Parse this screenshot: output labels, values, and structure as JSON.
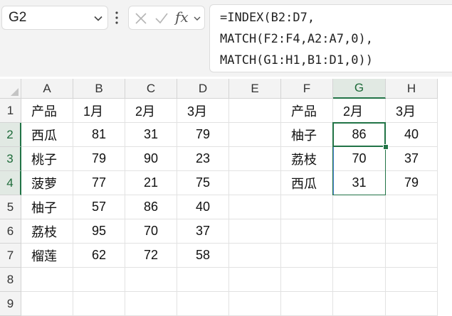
{
  "name_box": {
    "value": "G2"
  },
  "formula_bar": {
    "fx_label": "fx",
    "lines": [
      "=INDEX(B2:D7,",
      "MATCH(F2:F4,A2:A7,0),",
      "MATCH(G1:H1,B1:D1,0))"
    ]
  },
  "columns": [
    "A",
    "B",
    "C",
    "D",
    "E",
    "F",
    "G",
    "H"
  ],
  "rows": [
    "1",
    "2",
    "3",
    "4",
    "5",
    "6",
    "7",
    "8",
    "9"
  ],
  "cells": {
    "A1": "产品",
    "B1": "1月",
    "C1": "2月",
    "D1": "3月",
    "A2": "西瓜",
    "B2": "81",
    "C2": "31",
    "D2": "79",
    "A3": "桃子",
    "B3": "79",
    "C3": "90",
    "D3": "23",
    "A4": "菠萝",
    "B4": "77",
    "C4": "21",
    "D4": "75",
    "A5": "柚子",
    "B5": "57",
    "C5": "86",
    "D5": "40",
    "A6": "荔枝",
    "B6": "95",
    "C6": "70",
    "D6": "37",
    "A7": "榴莲",
    "B7": "62",
    "C7": "72",
    "D7": "58",
    "F1": "产品",
    "G1": "2月",
    "H1": "3月",
    "F2": "柚子",
    "G2": "86",
    "H2": "40",
    "F3": "荔枝",
    "G3": "70",
    "H3": "37",
    "F4": "西瓜",
    "G4": "31",
    "H4": "79"
  },
  "selection": {
    "active_cell": "G2",
    "range": "G2:G4",
    "spill_range": "G2:H4"
  },
  "colors": {
    "accent": "#217346",
    "spill_border": "#4a7fd6",
    "header_bg": "#f3f3f3"
  }
}
